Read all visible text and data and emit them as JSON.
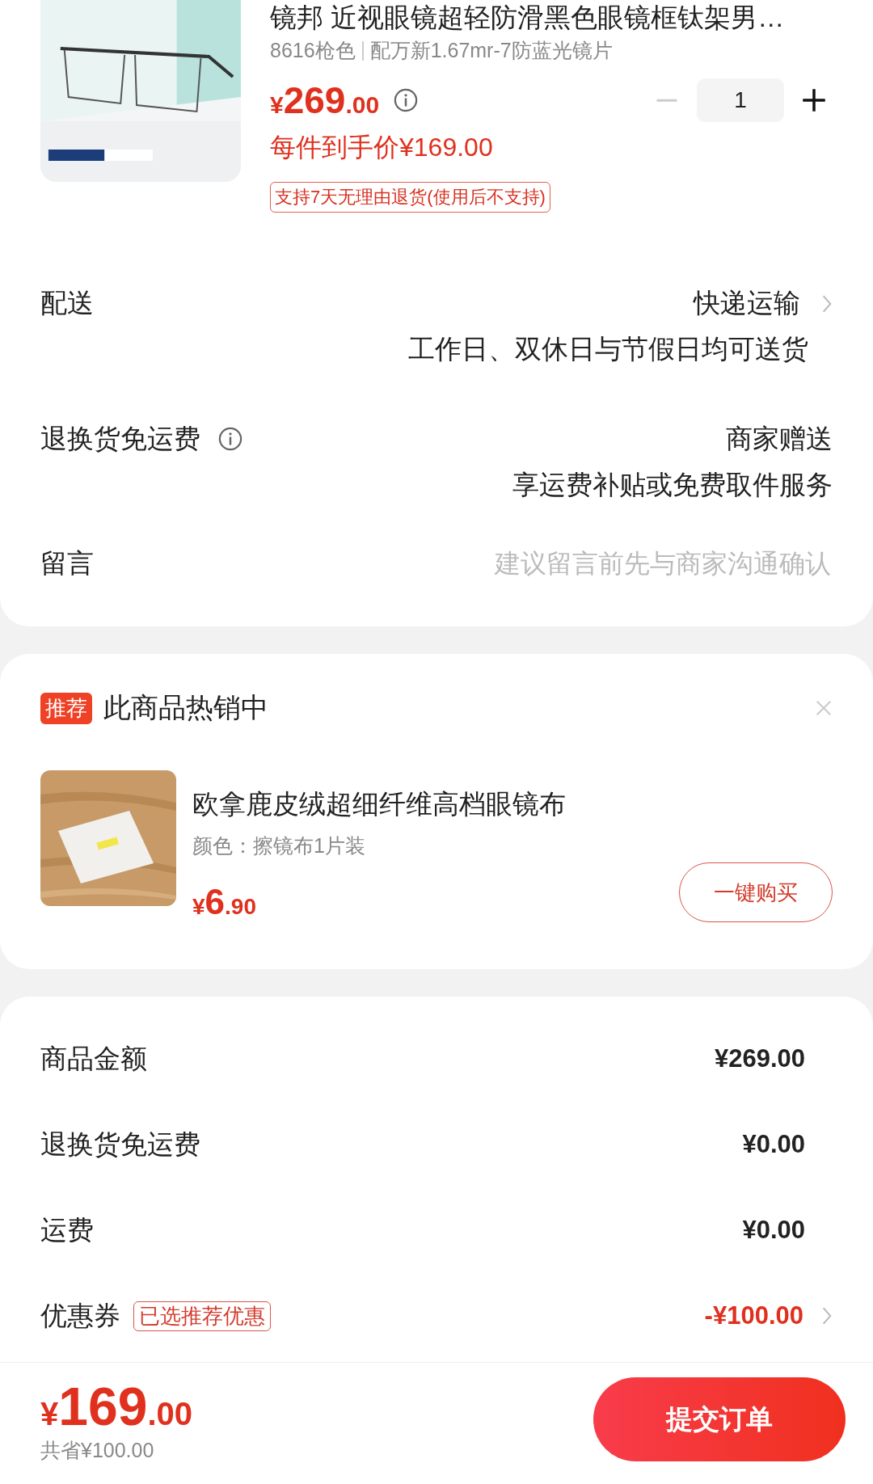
{
  "product": {
    "title": "镜邦 近视眼镜超轻防滑黑色眼镜框钛架男…",
    "spec": "8616枪色",
    "spec_2": "配万新1.67mr-7防蓝光镜片",
    "price": {
      "currency": "¥",
      "integer": "269",
      "decimal": ".00"
    },
    "net_price": "每件到手价¥169.00",
    "quantity": "1",
    "minus_disabled": true,
    "return_tag": "支持7天无理由退货(使用后不支持)"
  },
  "options": [
    {
      "kind": "option",
      "label": "配送",
      "info": false,
      "value": "快递运输",
      "note": "工作日、双休日与节假日均可送货",
      "chevron": true
    },
    {
      "kind": "option",
      "label": "退换货免运费",
      "info": true,
      "value": "商家赠送",
      "note": "享运费补贴或免费取件服务",
      "chevron": false
    },
    {
      "kind": "input",
      "label": "留言",
      "placeholder": "建议留言前先与商家沟通确认"
    }
  ],
  "recommend": {
    "badge": "推荐",
    "title": "此商品热销中",
    "item": {
      "name": "欧拿鹿皮绒超细纤维高档眼镜布",
      "spec": "颜色：擦镜布1片装",
      "price": {
        "currency": "¥",
        "integer": "6",
        "decimal": ".90"
      },
      "button": "一键购买"
    }
  },
  "summary": [
    {
      "label": "商品金额",
      "value": "¥269.00",
      "highlight": false,
      "chevron": false
    },
    {
      "label": "退换货免运费",
      "value": "¥0.00",
      "highlight": false,
      "chevron": false
    },
    {
      "label": "运费",
      "value": "¥0.00",
      "highlight": false,
      "chevron": false
    },
    {
      "label": "优惠券",
      "tag": "已选推荐优惠",
      "value": "-¥100.00",
      "highlight": true,
      "chevron": true
    }
  ],
  "footer": {
    "total": {
      "currency": "¥",
      "integer": "169",
      "decimal": ".00"
    },
    "saved": "共省¥100.00",
    "submit": "提交订单"
  }
}
